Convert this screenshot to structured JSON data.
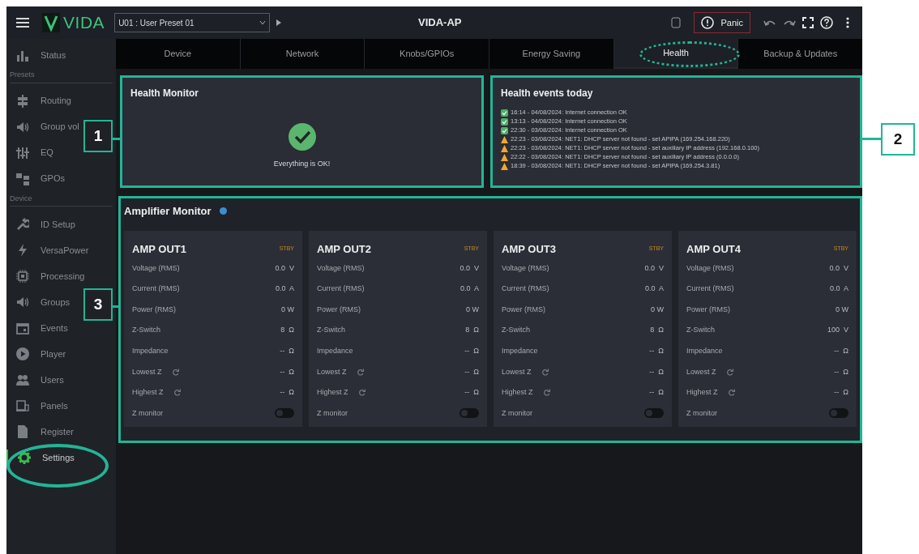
{
  "top_bar": {
    "logo": "VIDA",
    "preset": "U01 : User Preset 01",
    "title": "VIDA-AP",
    "panic": "Panic"
  },
  "sidebar": {
    "items": [
      {
        "kind": "item",
        "label": "Status",
        "selected": false
      },
      {
        "kind": "section",
        "label": "Presets"
      },
      {
        "kind": "item",
        "label": "Routing",
        "selected": false
      },
      {
        "kind": "item",
        "label": "Group vol",
        "selected": false
      },
      {
        "kind": "item",
        "label": "EQ",
        "selected": false
      },
      {
        "kind": "item",
        "label": "GPOs",
        "selected": false
      },
      {
        "kind": "section",
        "label": "Device"
      },
      {
        "kind": "item",
        "label": "ID Setup",
        "selected": false
      },
      {
        "kind": "item",
        "label": "VersaPower",
        "selected": false
      },
      {
        "kind": "item",
        "label": "Processing",
        "selected": false
      },
      {
        "kind": "item",
        "label": "Groups",
        "selected": false
      },
      {
        "kind": "item",
        "label": "Events",
        "selected": false
      },
      {
        "kind": "item",
        "label": "Player",
        "selected": false
      },
      {
        "kind": "item",
        "label": "Users",
        "selected": false
      },
      {
        "kind": "item",
        "label": "Panels",
        "selected": false
      },
      {
        "kind": "item",
        "label": "Register",
        "selected": false
      },
      {
        "kind": "item",
        "label": "Settings",
        "selected": true
      }
    ]
  },
  "tabs": [
    {
      "label": "Device",
      "selected": false
    },
    {
      "label": "Network",
      "selected": false
    },
    {
      "label": "Knobs/GPIOs",
      "selected": false
    },
    {
      "label": "Energy Saving",
      "selected": false
    },
    {
      "label": "Health",
      "selected": true
    },
    {
      "label": "Backup & Updates",
      "selected": false
    }
  ],
  "health_monitor": {
    "title": "Health Monitor",
    "status": "Everything is OK!"
  },
  "health_events": {
    "title": "Health events today",
    "events": [
      {
        "kind": "ok",
        "text": "16:14 - 04/08/2024: Internet connection OK"
      },
      {
        "kind": "ok",
        "text": "13:13 - 04/08/2024: Internet connection OK"
      },
      {
        "kind": "ok",
        "text": "22:30 - 03/08/2024: Internet connection OK"
      },
      {
        "kind": "warning",
        "text": "22:23 - 03/08/2024: NET1: DHCP server not found - set APIPA (169.254.168.220)"
      },
      {
        "kind": "warning",
        "text": "22:23 - 03/08/2024: NET1: DHCP server not found - set auxiliary IP address (192.168.0.100)"
      },
      {
        "kind": "warning",
        "text": "22:22 - 03/08/2024: NET1: DHCP server not found - set auxiliary IP address (0.0.0.0)"
      },
      {
        "kind": "warning",
        "text": "18:39 - 03/08/2024: NET1: DHCP server not found - set APIPA (169.254.3.81)"
      }
    ]
  },
  "amplifier_monitor": {
    "title": "Amplifier Monitor",
    "outputs": [
      {
        "name": "AMP OUT1",
        "status": "STBY",
        "rows": [
          {
            "kind": "reading",
            "label": "Voltage (RMS)",
            "value": "0.0  V"
          },
          {
            "kind": "reading",
            "label": "Current (RMS)",
            "value": "0.0  A"
          },
          {
            "kind": "reading",
            "label": "Power (RMS)",
            "value": "0 W"
          },
          {
            "kind": "reading",
            "label": "Z-Switch",
            "value": "8  Ω"
          },
          {
            "kind": "reading",
            "label": "Impedance",
            "value": "--  Ω"
          },
          {
            "kind": "reset",
            "label": "Lowest Z",
            "value": "--  Ω"
          },
          {
            "kind": "reset",
            "label": "Highest Z",
            "value": "--  Ω"
          },
          {
            "kind": "toggle",
            "label": "Z monitor",
            "on": false
          }
        ]
      },
      {
        "name": "AMP OUT2",
        "status": "STBY",
        "rows": [
          {
            "kind": "reading",
            "label": "Voltage (RMS)",
            "value": "0.0  V"
          },
          {
            "kind": "reading",
            "label": "Current (RMS)",
            "value": "0.0  A"
          },
          {
            "kind": "reading",
            "label": "Power (RMS)",
            "value": "0 W"
          },
          {
            "kind": "reading",
            "label": "Z-Switch",
            "value": "8  Ω"
          },
          {
            "kind": "reading",
            "label": "Impedance",
            "value": "--  Ω"
          },
          {
            "kind": "reset",
            "label": "Lowest Z",
            "value": "--  Ω"
          },
          {
            "kind": "reset",
            "label": "Highest Z",
            "value": "--  Ω"
          },
          {
            "kind": "toggle",
            "label": "Z monitor",
            "on": false
          }
        ]
      },
      {
        "name": "AMP OUT3",
        "status": "STBY",
        "rows": [
          {
            "kind": "reading",
            "label": "Voltage (RMS)",
            "value": "0.0  V"
          },
          {
            "kind": "reading",
            "label": "Current (RMS)",
            "value": "0.0  A"
          },
          {
            "kind": "reading",
            "label": "Power (RMS)",
            "value": "0 W"
          },
          {
            "kind": "reading",
            "label": "Z-Switch",
            "value": "8  Ω"
          },
          {
            "kind": "reading",
            "label": "Impedance",
            "value": "--  Ω"
          },
          {
            "kind": "reset",
            "label": "Lowest Z",
            "value": "--  Ω"
          },
          {
            "kind": "reset",
            "label": "Highest Z",
            "value": "--  Ω"
          },
          {
            "kind": "toggle",
            "label": "Z monitor",
            "on": false
          }
        ]
      },
      {
        "name": "AMP OUT4",
        "status": "STBY",
        "rows": [
          {
            "kind": "reading",
            "label": "Voltage (RMS)",
            "value": "0.0  V"
          },
          {
            "kind": "reading",
            "label": "Current (RMS)",
            "value": "0.0  A"
          },
          {
            "kind": "reading",
            "label": "Power (RMS)",
            "value": "0 W"
          },
          {
            "kind": "reading",
            "label": "Z-Switch",
            "value": "100  V"
          },
          {
            "kind": "reading",
            "label": "Impedance",
            "value": "--  Ω"
          },
          {
            "kind": "reset",
            "label": "Lowest Z",
            "value": "--  Ω"
          },
          {
            "kind": "reset",
            "label": "Highest Z",
            "value": "--  Ω"
          },
          {
            "kind": "toggle",
            "label": "Z monitor",
            "on": false
          }
        ]
      }
    ]
  },
  "callouts": [
    {
      "label": "1"
    },
    {
      "label": "2"
    },
    {
      "label": "3"
    }
  ]
}
